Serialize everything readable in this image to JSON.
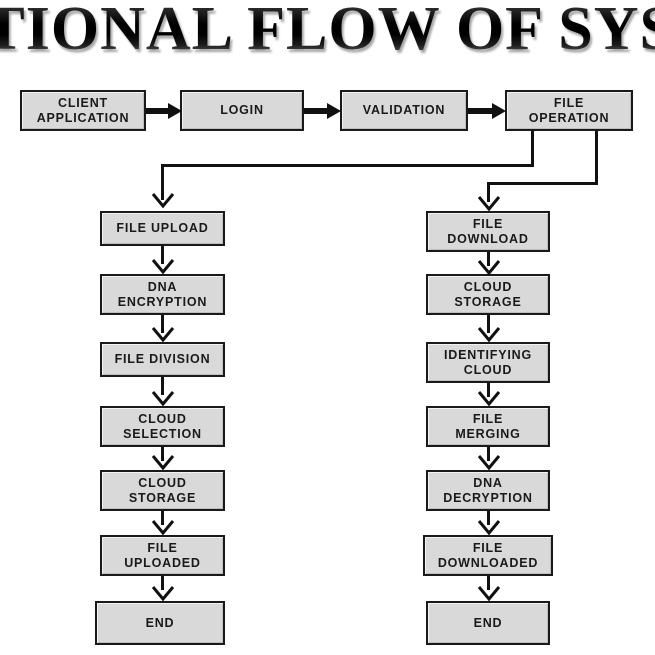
{
  "title": "CTIONAL FLOW OF SYST",
  "colors": {
    "background": "#ffffff",
    "node_fill": "#d9d9d9",
    "node_border": "#1a1a1a",
    "connector": "#111111",
    "text": "#1a1a1a"
  },
  "diagram": {
    "type": "flowchart",
    "top_row": [
      {
        "id": "client-application",
        "label": "CLIENT\nAPPLICATION"
      },
      {
        "id": "login",
        "label": "LOGIN"
      },
      {
        "id": "validation",
        "label": "VALIDATION"
      },
      {
        "id": "file-operation",
        "label": "FILE\nOPERATION"
      }
    ],
    "upload_branch": [
      {
        "id": "file-upload",
        "label": "FILE UPLOAD"
      },
      {
        "id": "dna-encryption",
        "label": "DNA\nENCRYPTION"
      },
      {
        "id": "file-division",
        "label": "FILE DIVISION"
      },
      {
        "id": "cloud-selection",
        "label": "CLOUD\nSELECTION"
      },
      {
        "id": "cloud-storage-upload",
        "label": "CLOUD\nSTORAGE"
      },
      {
        "id": "file-uploaded",
        "label": "FILE\nUPLOADED"
      },
      {
        "id": "end-upload",
        "label": "END"
      }
    ],
    "download_branch": [
      {
        "id": "file-download",
        "label": "FILE\nDOWNLOAD"
      },
      {
        "id": "cloud-storage-download",
        "label": "CLOUD\nSTORAGE"
      },
      {
        "id": "identifying-cloud",
        "label": "IDENTIFYING\nCLOUD"
      },
      {
        "id": "file-merging",
        "label": "FILE\nMERGING"
      },
      {
        "id": "dna-decryption",
        "label": "DNA\nDECRYPTION"
      },
      {
        "id": "file-downloaded",
        "label": "FILE\nDOWNLOADED"
      },
      {
        "id": "end-download",
        "label": "END"
      }
    ]
  }
}
